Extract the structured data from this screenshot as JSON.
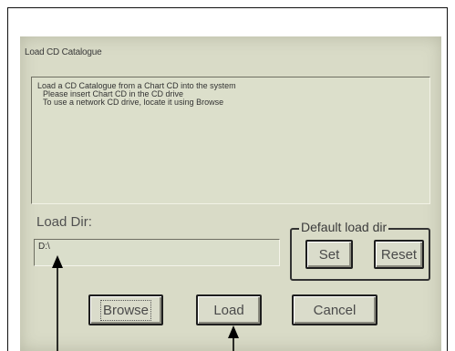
{
  "window": {
    "title": "Load CD Catalogue"
  },
  "message": {
    "lines": [
      "Load a CD Catalogue from a Chart CD into the system",
      "Please insert Chart CD in the CD drive",
      "To use a network CD drive, locate it using Browse"
    ]
  },
  "load_dir": {
    "label": "Load Dir:",
    "value": "D:\\"
  },
  "default_group": {
    "legend": "Default load dir",
    "set_label": "Set",
    "reset_label": "Reset"
  },
  "buttons": {
    "browse_label": "Browse",
    "load_label": "Load",
    "cancel_label": "Cancel"
  },
  "colors": {
    "screen_bg": "#d9dbc7",
    "text": "#4a4a4a"
  }
}
